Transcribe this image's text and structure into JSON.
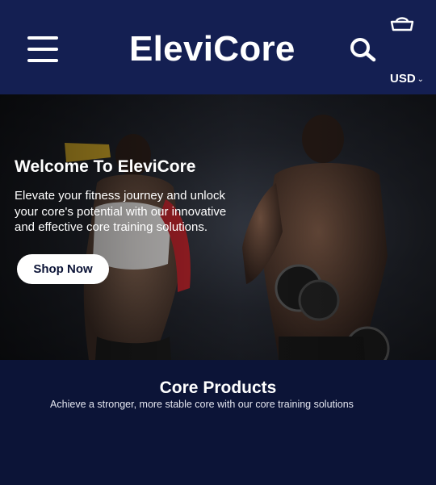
{
  "header": {
    "brand": "EleviCore",
    "currency": "USD",
    "icons": {
      "menu": "hamburger-menu-icon",
      "search": "search-icon",
      "cart": "cart-icon",
      "caret": "chevron-down-icon"
    }
  },
  "hero": {
    "title": "Welcome To EleviCore",
    "text": "Elevate your fitness journey and unlock\n your core's potential with our innovative\nand effective core training solutions.",
    "cta_label": "Shop Now"
  },
  "products": {
    "title": "Core Products",
    "subtitle": "Achieve a stronger, more stable core with our core training solutions"
  },
  "colors": {
    "header_bg": "#141f52",
    "page_bg": "#0c1437",
    "button_bg": "#ffffff"
  }
}
